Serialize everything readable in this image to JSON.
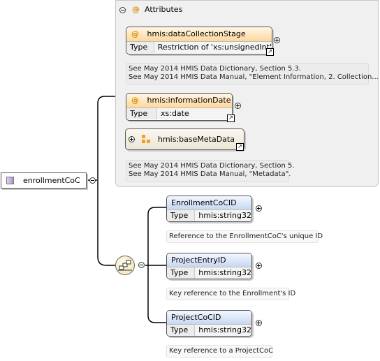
{
  "root": {
    "name": "enrollmentCoC"
  },
  "attributes_group": {
    "title": "Attributes",
    "items": [
      {
        "name": "hmis:dataCollectionStage",
        "type_label": "Type",
        "type_value": "Restriction of 'xs:unsignedInt'",
        "doc": [
          "See May 2014 HMIS Data Dictionary, Section 5.3.",
          "See May 2014 HMIS Data Manual, \"Element Information, 2. Collection..."
        ]
      },
      {
        "name": "hmis:informationDate",
        "type_label": "Type",
        "type_value": "xs:date"
      }
    ],
    "attribute_group_ref": {
      "name": "hmis:baseMetaData",
      "doc": [
        "See May 2014 HMIS Data Dictionary, Section 5.",
        "See May 2014 HMIS Data Manual, \"Metadata\"."
      ]
    }
  },
  "sequence": {
    "elements": [
      {
        "name": "EnrollmentCoCID",
        "type_label": "Type",
        "type_value": "hmis:string32",
        "doc": "Reference to the EnrollmentCoC's unique ID"
      },
      {
        "name": "ProjectEntryID",
        "type_label": "Type",
        "type_value": "hmis:string32",
        "doc": "Key reference to the Enrollment's ID"
      },
      {
        "name": "ProjectCoCID",
        "type_label": "Type",
        "type_value": "hmis:string32",
        "doc": "Key reference to a ProjectCoC"
      }
    ]
  },
  "icons": {
    "at": "@",
    "ref_arrow": "↗"
  },
  "colors": {
    "attribute_header": "#ffd79a",
    "element_header": "#c7d7f1",
    "panel_background": "#f0f0f0",
    "root_icon": "#a990c9",
    "sequence_fill": "#f1e2a8"
  }
}
